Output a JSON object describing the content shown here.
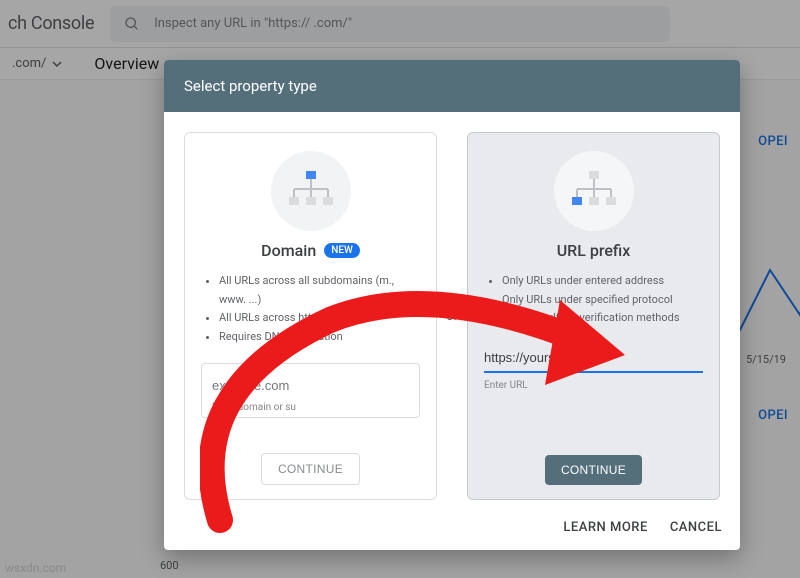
{
  "header": {
    "brand": "ch Console",
    "search_placeholder": "Inspect any URL in \"https://                   .com/\""
  },
  "subbar": {
    "property_label": ".com/",
    "page_title": "Overview"
  },
  "background": {
    "date_label": "5/15/19",
    "open_label": "OPEI",
    "y_tick": "600"
  },
  "dialog": {
    "title": "Select property type",
    "or": "or",
    "domain_card": {
      "title": "Domain",
      "badge": "NEW",
      "bullets": [
        "All URLs across all subdomains (m., www. ...)",
        "All URLs across https or http",
        "Requires DNS verification"
      ],
      "placeholder": "example.com",
      "hint": "Enter domain or su",
      "continue": "CONTINUE"
    },
    "url_card": {
      "title": "URL prefix",
      "bullets": [
        "Only URLs under entered address",
        "Only URLs under specified protocol",
        "Allows multiple verification methods"
      ],
      "value": "https://yoursite.com",
      "hint": "Enter URL",
      "continue": "CONTINUE"
    },
    "learn_more": "LEARN MORE",
    "cancel": "CANCEL"
  },
  "watermark": "wsxdn.com"
}
